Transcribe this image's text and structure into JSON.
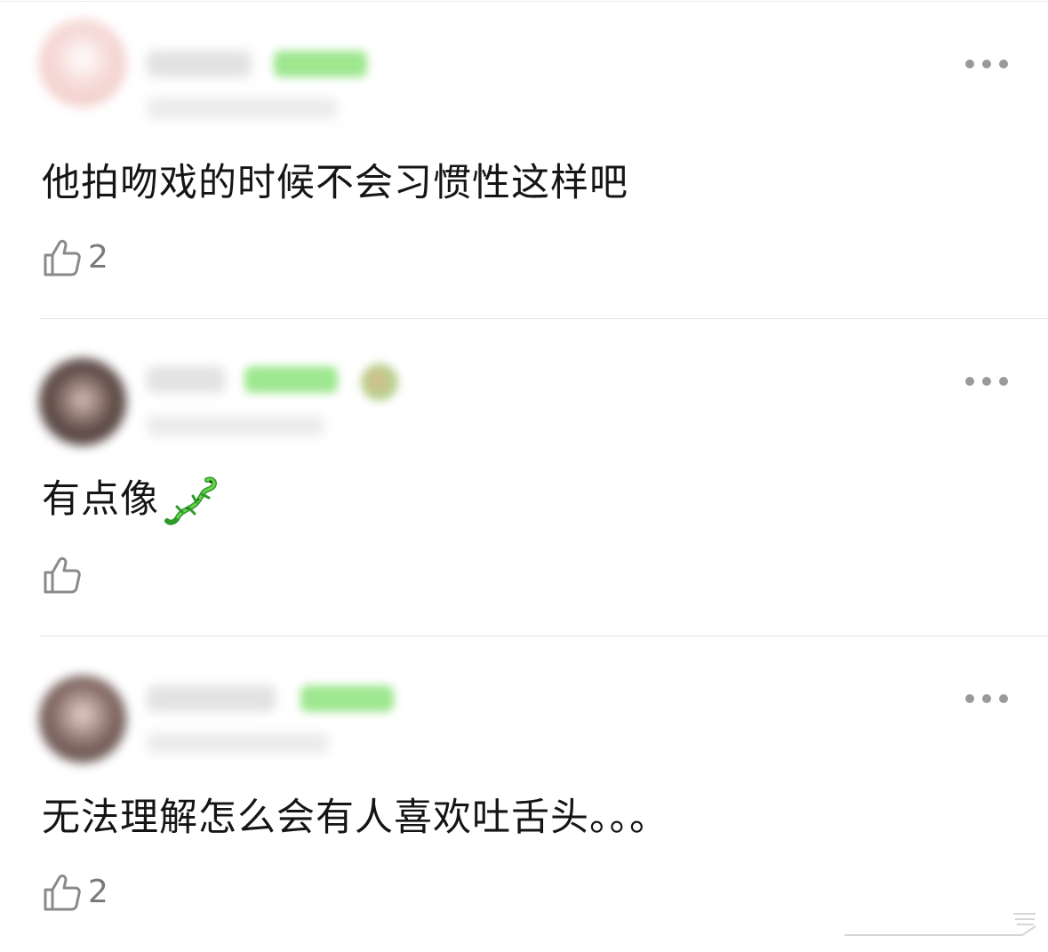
{
  "comments": [
    {
      "text": "他拍吻戏的时候不会习惯性这样吧",
      "likes": "2",
      "avatar_color": "#f3c9c6"
    },
    {
      "text": "有点像",
      "emoji": "lizard",
      "likes": "",
      "avatar_color": "#6b5a55"
    },
    {
      "text": "无法理解怎么会有人喜欢吐舌头。。。",
      "likes": "2",
      "avatar_color": "#8a6f6a"
    }
  ],
  "icons": {
    "like": "thumbs-up-outline-icon",
    "more": "more-dots-icon",
    "emoji": "lizard-emoji-icon"
  },
  "colors": {
    "level_badge": "#9ee78f",
    "like_icon": "#8a8a8a",
    "more_dots": "#9a9a9a",
    "divider": "#e4e4e4"
  }
}
